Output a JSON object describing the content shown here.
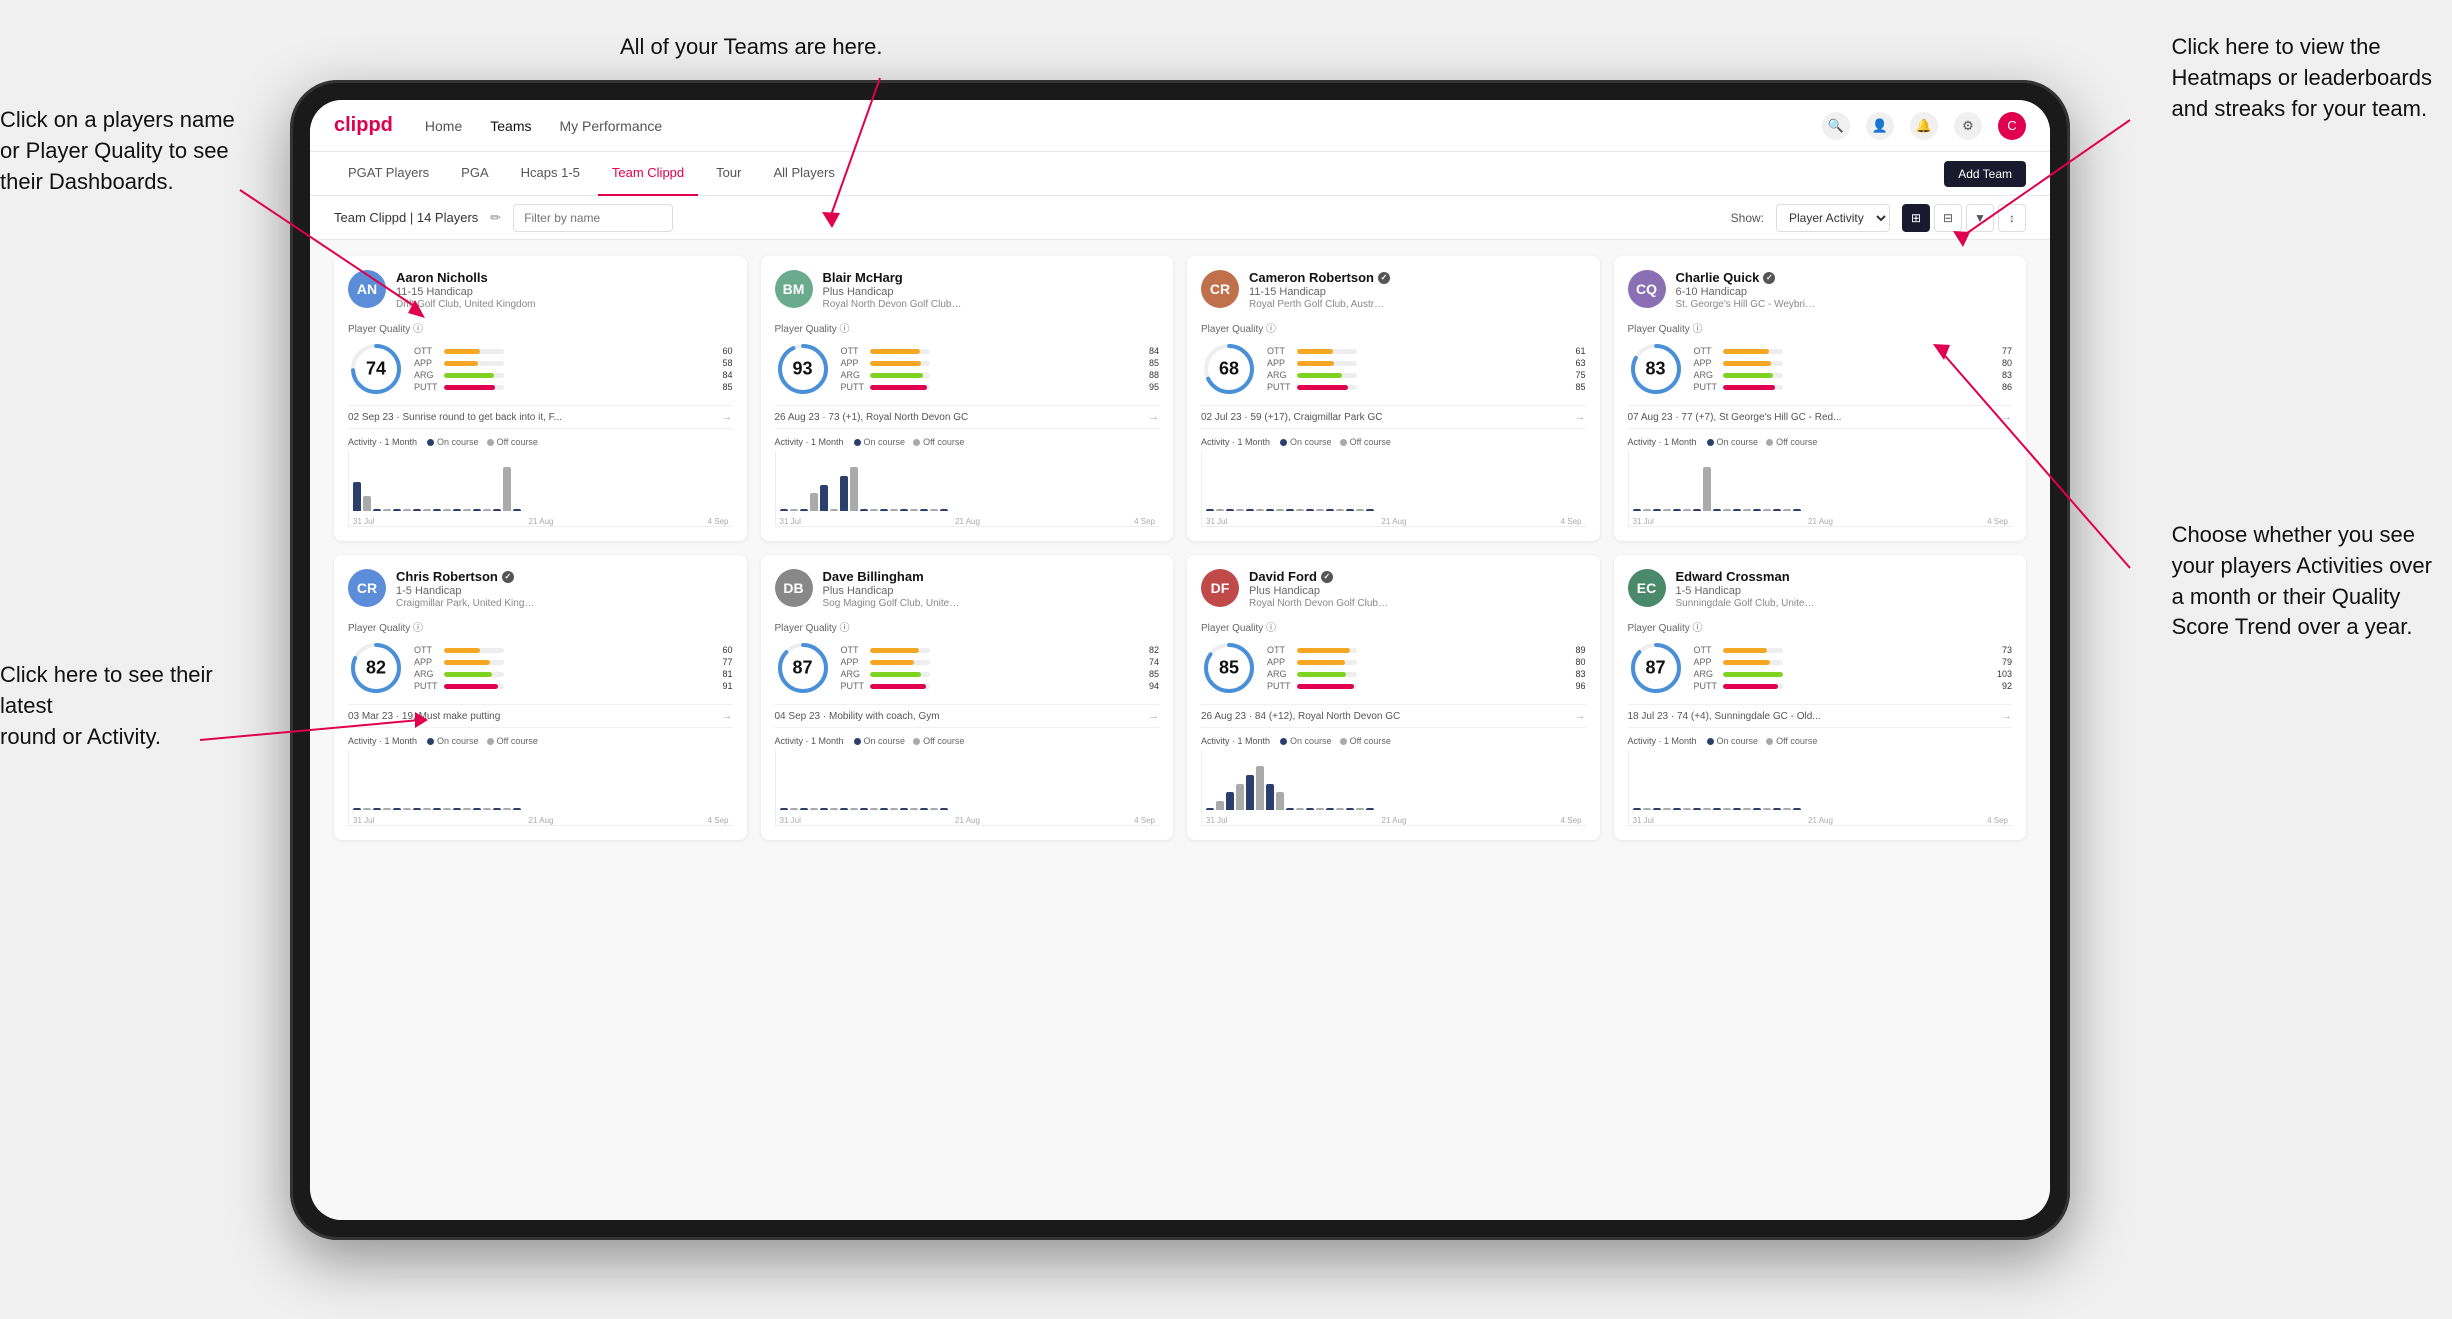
{
  "annotations": {
    "top_left_title": "Click on a players name\nor Player Quality to see\ntheir Dashboards.",
    "bottom_left_title": "Click here to see their latest\nround or Activity.",
    "top_center_title": "All of your Teams are here.",
    "top_right_title": "Click here to view the\nHeatmaps or leaderboards\nand streaks for your team.",
    "bottom_right_title": "Choose whether you see\nyour players Activities over\na month or their Quality\nScore Trend over a year."
  },
  "nav": {
    "logo": "clippd",
    "items": [
      "Home",
      "Teams",
      "My Performance"
    ],
    "active": "Teams",
    "add_team_label": "Add Team"
  },
  "tabs": {
    "items": [
      "PGAT Players",
      "PGA",
      "Hcaps 1-5",
      "Team Clippd",
      "Tour",
      "All Players"
    ],
    "active": "Team Clippd"
  },
  "filter": {
    "team_label": "Team Clippd | 14 Players",
    "search_placeholder": "Filter by name",
    "show_label": "Show:",
    "show_option": "Player Activity",
    "view_options": [
      "grid-2",
      "grid-3",
      "filter",
      "sort"
    ]
  },
  "players": [
    {
      "name": "Aaron Nicholls",
      "handicap": "11-15 Handicap",
      "club": "Drift Golf Club, United Kingdom",
      "quality": 74,
      "quality_color": "#4a90d9",
      "stats": {
        "OTT": {
          "val": 60,
          "color": "#f5a623"
        },
        "APP": {
          "val": 58,
          "color": "#f5a623"
        },
        "ARG": {
          "val": 84,
          "color": "#7ed321"
        },
        "PUTT": {
          "val": 85,
          "color": "#e0004d"
        }
      },
      "latest_round": "02 Sep 23 · Sunrise round to get back into it, F...",
      "activity_bars": [
        2,
        1,
        0,
        0,
        0,
        0,
        0,
        0,
        0,
        0,
        0,
        0,
        0,
        0,
        0,
        3,
        0
      ],
      "chart_labels": [
        "31 Jul",
        "21 Aug",
        "4 Sep"
      ],
      "avatar_color": "#5b8dd9",
      "initials": "AN",
      "verified": false
    },
    {
      "name": "Blair McHarg",
      "handicap": "Plus Handicap",
      "club": "Royal North Devon Golf Club, United Kin...",
      "quality": 93,
      "quality_color": "#4a90d9",
      "stats": {
        "OTT": {
          "val": 84,
          "color": "#f5a623"
        },
        "APP": {
          "val": 85,
          "color": "#f5a623"
        },
        "ARG": {
          "val": 88,
          "color": "#7ed321"
        },
        "PUTT": {
          "val": 95,
          "color": "#e0004d"
        }
      },
      "latest_round": "26 Aug 23 · 73 (+1), Royal North Devon GC",
      "activity_bars": [
        0,
        0,
        0,
        2,
        3,
        0,
        4,
        5,
        0,
        0,
        0,
        0,
        0,
        0,
        0,
        0,
        0
      ],
      "chart_labels": [
        "31 Jul",
        "21 Aug",
        "4 Sep"
      ],
      "avatar_color": "#6aab8e",
      "initials": "BM",
      "verified": false
    },
    {
      "name": "Cameron Robertson",
      "handicap": "11-15 Handicap",
      "club": "Royal Perth Golf Club, Australia",
      "quality": 68,
      "quality_color": "#4a90d9",
      "stats": {
        "OTT": {
          "val": 61,
          "color": "#f5a623"
        },
        "APP": {
          "val": 63,
          "color": "#f5a623"
        },
        "ARG": {
          "val": 75,
          "color": "#7ed321"
        },
        "PUTT": {
          "val": 85,
          "color": "#e0004d"
        }
      },
      "latest_round": "02 Jul 23 · 59 (+17), Craigmillar Park GC",
      "activity_bars": [
        0,
        0,
        0,
        0,
        0,
        0,
        0,
        0,
        0,
        0,
        0,
        0,
        0,
        0,
        0,
        0,
        0
      ],
      "chart_labels": [
        "31 Jul",
        "21 Aug",
        "4 Sep"
      ],
      "avatar_color": "#c0704a",
      "initials": "CR",
      "verified": true
    },
    {
      "name": "Charlie Quick",
      "handicap": "6-10 Handicap",
      "club": "St. George's Hill GC - Weybridge - Surrey...",
      "quality": 83,
      "quality_color": "#4a90d9",
      "stats": {
        "OTT": {
          "val": 77,
          "color": "#f5a623"
        },
        "APP": {
          "val": 80,
          "color": "#f5a623"
        },
        "ARG": {
          "val": 83,
          "color": "#7ed321"
        },
        "PUTT": {
          "val": 86,
          "color": "#e0004d"
        }
      },
      "latest_round": "07 Aug 23 · 77 (+7), St George's Hill GC - Red...",
      "activity_bars": [
        0,
        0,
        0,
        0,
        0,
        0,
        0,
        3,
        0,
        0,
        0,
        0,
        0,
        0,
        0,
        0,
        0
      ],
      "chart_labels": [
        "31 Jul",
        "21 Aug",
        "4 Sep"
      ],
      "avatar_color": "#8b6fb5",
      "initials": "CQ",
      "verified": true
    },
    {
      "name": "Chris Robertson",
      "handicap": "1-5 Handicap",
      "club": "Craigmillar Park, United Kingdom",
      "quality": 82,
      "quality_color": "#4a90d9",
      "stats": {
        "OTT": {
          "val": 60,
          "color": "#f5a623"
        },
        "APP": {
          "val": 77,
          "color": "#f5a623"
        },
        "ARG": {
          "val": 81,
          "color": "#7ed321"
        },
        "PUTT": {
          "val": 91,
          "color": "#e0004d"
        }
      },
      "latest_round": "03 Mar 23 · 19, Must make putting",
      "activity_bars": [
        0,
        0,
        0,
        0,
        0,
        0,
        0,
        0,
        0,
        0,
        0,
        0,
        0,
        0,
        0,
        0,
        0
      ],
      "chart_labels": [
        "31 Jul",
        "21 Aug",
        "4 Sep"
      ],
      "avatar_color": "#5b8dd9",
      "initials": "CR",
      "verified": true
    },
    {
      "name": "Dave Billingham",
      "handicap": "Plus Handicap",
      "club": "Sog Maging Golf Club, United Kingdom",
      "quality": 87,
      "quality_color": "#4a90d9",
      "stats": {
        "OTT": {
          "val": 82,
          "color": "#f5a623"
        },
        "APP": {
          "val": 74,
          "color": "#f5a623"
        },
        "ARG": {
          "val": 85,
          "color": "#7ed321"
        },
        "PUTT": {
          "val": 94,
          "color": "#e0004d"
        }
      },
      "latest_round": "04 Sep 23 · Mobility with coach, Gym",
      "activity_bars": [
        0,
        0,
        0,
        0,
        0,
        0,
        0,
        0,
        0,
        0,
        0,
        0,
        0,
        0,
        0,
        0,
        0
      ],
      "chart_labels": [
        "31 Jul",
        "21 Aug",
        "4 Sep"
      ],
      "avatar_color": "#888",
      "initials": "DB",
      "verified": false
    },
    {
      "name": "David Ford",
      "handicap": "Plus Handicap",
      "club": "Royal North Devon Golf Club, United Kib...",
      "quality": 85,
      "quality_color": "#4a90d9",
      "stats": {
        "OTT": {
          "val": 89,
          "color": "#f5a623"
        },
        "APP": {
          "val": 80,
          "color": "#f5a623"
        },
        "ARG": {
          "val": 83,
          "color": "#7ed321"
        },
        "PUTT": {
          "val": 96,
          "color": "#e0004d"
        }
      },
      "latest_round": "26 Aug 23 · 84 (+12), Royal North Devon GC",
      "activity_bars": [
        0,
        1,
        2,
        3,
        4,
        5,
        3,
        2,
        0,
        0,
        0,
        0,
        0,
        0,
        0,
        0,
        0
      ],
      "chart_labels": [
        "31 Jul",
        "21 Aug",
        "4 Sep"
      ],
      "avatar_color": "#c04a4a",
      "initials": "DF",
      "verified": true
    },
    {
      "name": "Edward Crossman",
      "handicap": "1-5 Handicap",
      "club": "Sunningdale Golf Club, United Kingdom",
      "quality": 87,
      "quality_color": "#4a90d9",
      "stats": {
        "OTT": {
          "val": 73,
          "color": "#f5a623"
        },
        "APP": {
          "val": 79,
          "color": "#f5a623"
        },
        "ARG": {
          "val": 103,
          "color": "#7ed321"
        },
        "PUTT": {
          "val": 92,
          "color": "#e0004d"
        }
      },
      "latest_round": "18 Jul 23 · 74 (+4), Sunningdale GC - Old...",
      "activity_bars": [
        0,
        0,
        0,
        0,
        0,
        0,
        0,
        0,
        0,
        0,
        0,
        0,
        0,
        0,
        0,
        0,
        0
      ],
      "chart_labels": [
        "31 Jul",
        "21 Aug",
        "4 Sep"
      ],
      "avatar_color": "#4a8a6a",
      "initials": "EC",
      "verified": false
    }
  ],
  "activity": {
    "title": "Activity",
    "period": "1 Month",
    "on_course_label": "On course",
    "off_course_label": "Off course",
    "on_course_color": "#2c3e6b",
    "off_course_color": "#aaa"
  }
}
